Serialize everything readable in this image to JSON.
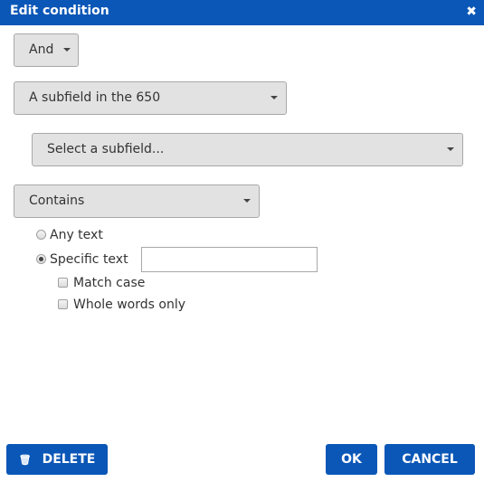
{
  "dialog": {
    "title": "Edit condition",
    "close_icon": "close-icon"
  },
  "operator": {
    "value": "And"
  },
  "field": {
    "value": "A subfield in the 650"
  },
  "subfield": {
    "value": "Select a subfield..."
  },
  "comparison": {
    "value": "Contains"
  },
  "text_mode": {
    "options": [
      {
        "label": "Any text",
        "selected": false
      },
      {
        "label": "Specific text",
        "selected": true
      }
    ],
    "specific_text_value": ""
  },
  "options": {
    "match_case": {
      "label": "Match case",
      "checked": false
    },
    "whole_words": {
      "label": "Whole words only",
      "checked": false
    }
  },
  "footer": {
    "delete_label": "DELETE",
    "delete_icon": "trash-icon",
    "ok_label": "OK",
    "cancel_label": "CANCEL"
  }
}
